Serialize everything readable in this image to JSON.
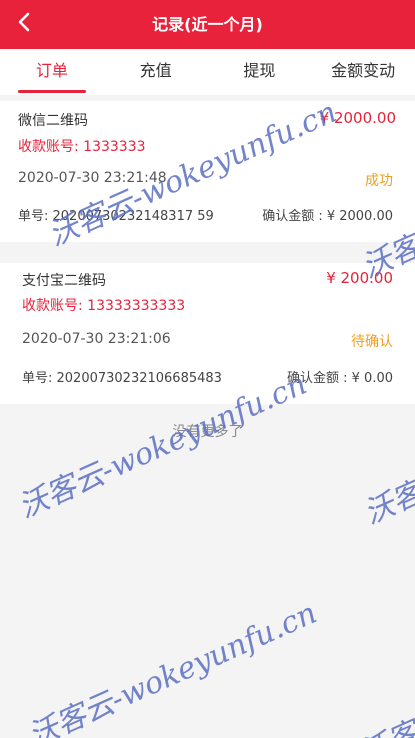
{
  "header": {
    "title": "记录(近一个月)"
  },
  "tabs": [
    {
      "label": "订单",
      "active": true
    },
    {
      "label": "充值",
      "active": false
    },
    {
      "label": "提现",
      "active": false
    },
    {
      "label": "金额变动",
      "active": false
    }
  ],
  "records": [
    {
      "title": "微信二维码",
      "amount": "¥ 2000.00",
      "account": "收款账号: 1333333",
      "time": "2020-07-30 23:21:48",
      "status": "成功",
      "order_no": "单号: 20200730232148317 59",
      "confirm_amount": "确认金额 : ¥ 2000.00"
    },
    {
      "title": "支付宝二维码",
      "amount": "¥ 200.00",
      "account": "收款账号: 13333333333",
      "time": "2020-07-30 23:21:06",
      "status": "待确认",
      "order_no": "单号: 20200730232106685483",
      "confirm_amount": "确认金额 : ¥ 0.00"
    }
  ],
  "footer": {
    "no_more": "没有更多了"
  },
  "watermark": {
    "text": "沃客云-wokeyunfu.cn",
    "edge_text": "沃客"
  },
  "colors": {
    "primary": "#e8223b",
    "status_pending": "#f0a020",
    "watermark": "#5b6fc2"
  }
}
